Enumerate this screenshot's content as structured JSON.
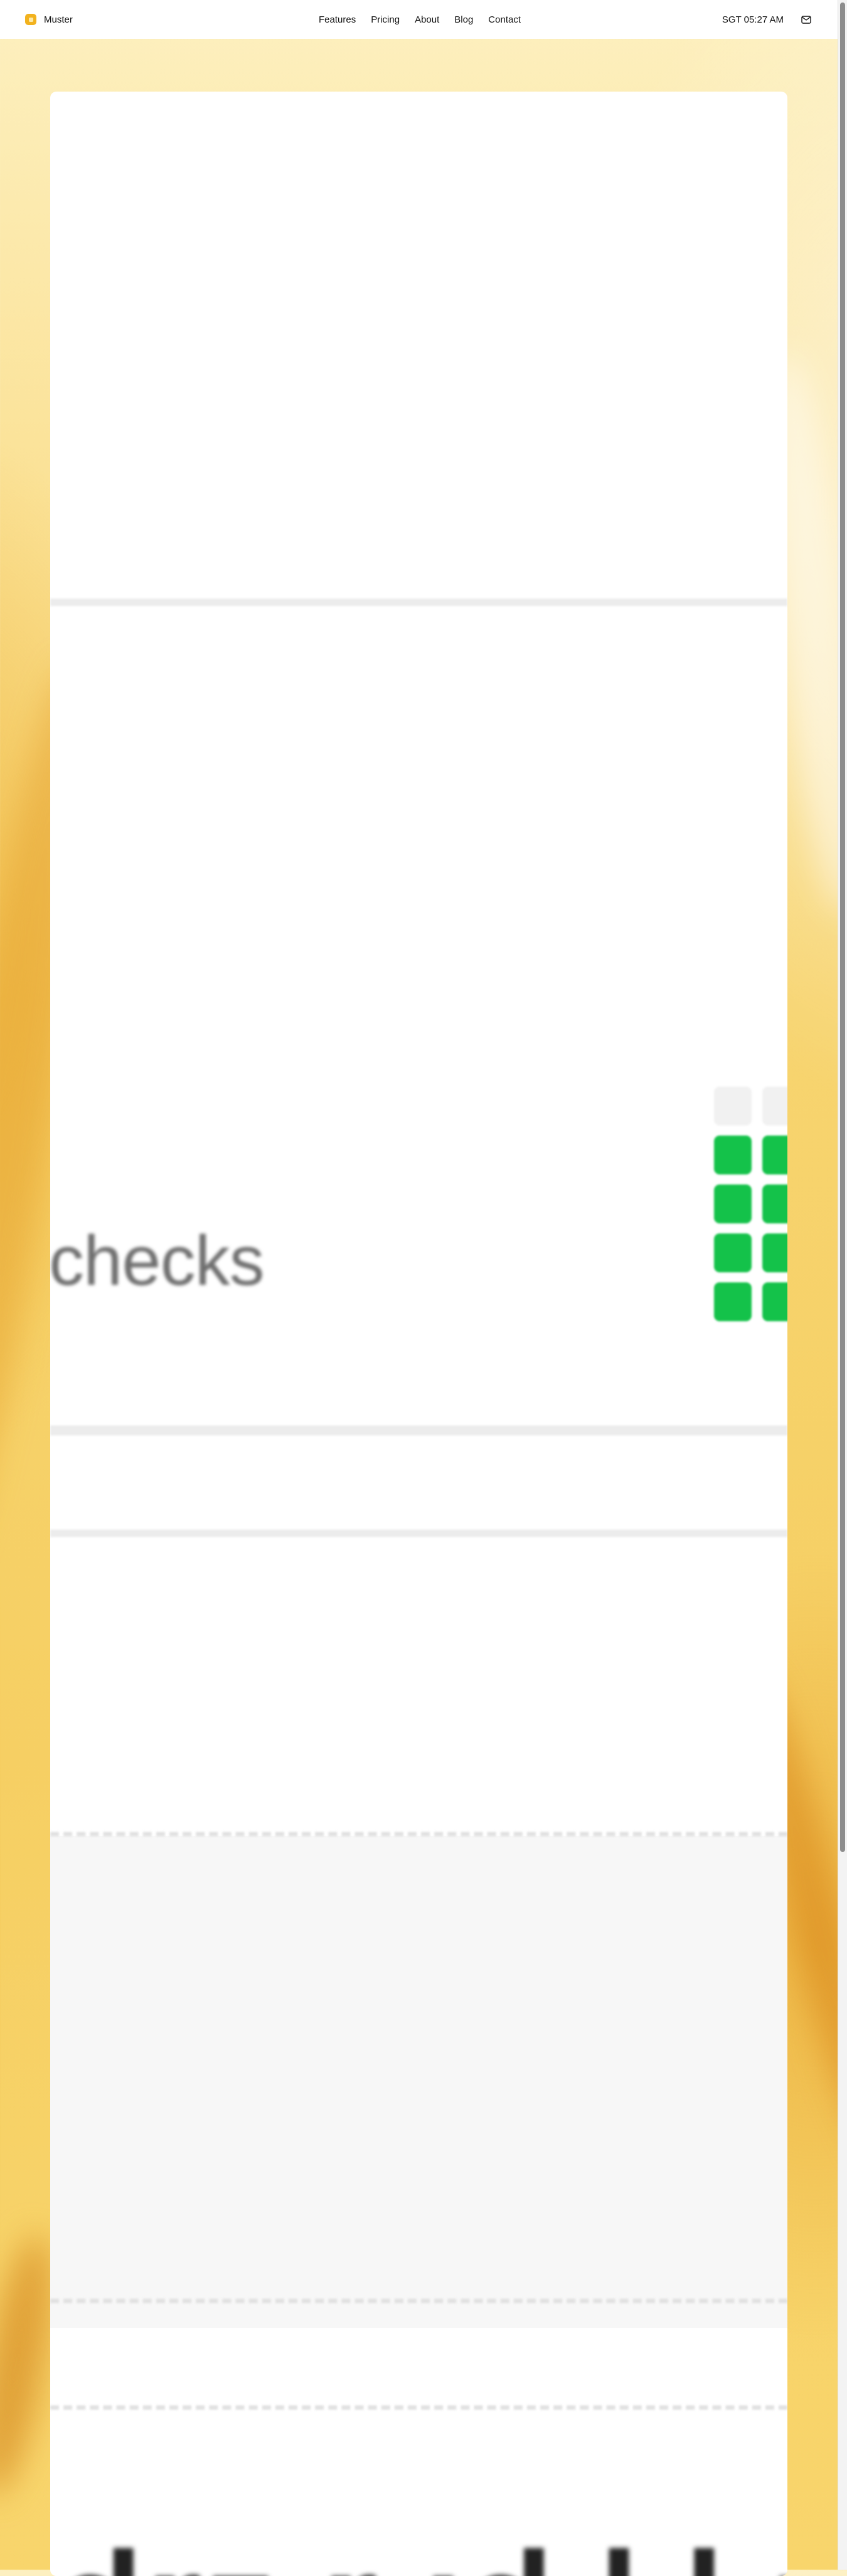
{
  "brand": {
    "name": "Muster",
    "accent_color": "#f2b21e"
  },
  "nav": {
    "links": [
      "Features",
      "Pricing",
      "About",
      "Blog",
      "Contact"
    ]
  },
  "header_right": {
    "clock": "SGT 05:27 AM",
    "mail_icon": "mail-icon"
  },
  "hero": {
    "checks_label": "checks",
    "checks_grid": {
      "filled_color": "#14c24a",
      "rows": [
        [
          "empty",
          "empty"
        ],
        [
          "filled",
          "filled"
        ],
        [
          "filled",
          "filled"
        ],
        [
          "filled",
          "filled"
        ],
        [
          "filled",
          "filled"
        ]
      ]
    }
  },
  "bottom_heading": "drz r ıd l l ı ı"
}
